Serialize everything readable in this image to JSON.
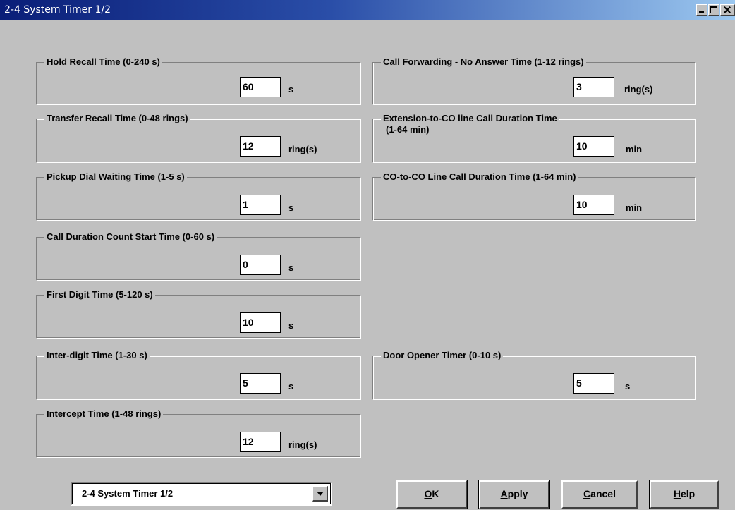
{
  "window": {
    "title": "2-4 System Timer 1/2"
  },
  "left_groups": [
    {
      "label": "Hold Recall Time (0-240 s)",
      "value": "60",
      "unit": "s"
    },
    {
      "label": "Transfer Recall Time (0-48 rings)",
      "value": "12",
      "unit": "ring(s)"
    },
    {
      "label": "Pickup Dial Waiting Time (1-5 s)",
      "value": "1",
      "unit": "s"
    },
    {
      "label": "Call Duration Count Start Time (0-60 s)",
      "value": "0",
      "unit": "s"
    },
    {
      "label": "First Digit Time (5-120 s)",
      "value": "10",
      "unit": "s"
    },
    {
      "label": "Inter-digit Time (1-30 s)",
      "value": "5",
      "unit": "s"
    },
    {
      "label": "Intercept Time (1-48 rings)",
      "value": "12",
      "unit": "ring(s)"
    }
  ],
  "right_groups": [
    {
      "label": "Call Forwarding - No Answer Time (1-12 rings)",
      "value": "3",
      "unit": "ring(s)"
    },
    {
      "label": "Extension-to-CO line Call Duration Time",
      "label_line2": "(1-64 min)",
      "value": "10",
      "unit": "min"
    },
    {
      "label": "CO-to-CO Line Call Duration Time (1-64 min)",
      "value": "10",
      "unit": "min"
    },
    {
      "label": "Door Opener Timer (0-10 s)",
      "value": "5",
      "unit": "s"
    }
  ],
  "footer": {
    "page_select": "2-4 System Timer 1/2",
    "buttons": {
      "ok": {
        "mnemonic": "O",
        "rest": "K"
      },
      "apply": {
        "mnemonic": "A",
        "rest": "pply"
      },
      "cancel": {
        "mnemonic": "C",
        "rest": "ancel"
      },
      "help": {
        "mnemonic": "H",
        "rest": "elp"
      }
    }
  },
  "icons": [
    "minimize-icon",
    "maximize-icon",
    "close-icon",
    "dropdown-arrow-icon"
  ]
}
